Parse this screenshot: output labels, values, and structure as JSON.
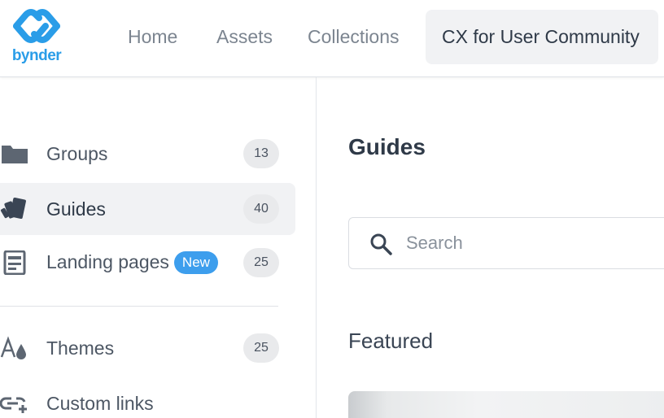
{
  "brand": {
    "logo_text": "bynder",
    "logo_color": "#2a9de8"
  },
  "nav": {
    "home": "Home",
    "assets": "Assets",
    "collections": "Collections",
    "active_portal": "CX for User Community"
  },
  "sidebar": {
    "items": [
      {
        "label": "Groups",
        "count": "13",
        "icon": "folder-icon"
      },
      {
        "label": "Guides",
        "count": "40",
        "icon": "guides-icon",
        "active": true
      },
      {
        "label": "Landing pages",
        "count": "25",
        "icon": "page-icon",
        "badge": "New"
      },
      {
        "label": "Themes",
        "count": "25",
        "icon": "theme-icon"
      },
      {
        "label": "Custom links",
        "icon": "custom-link-icon"
      }
    ]
  },
  "main": {
    "title": "Guides",
    "search": {
      "placeholder": "Search",
      "value": ""
    },
    "featured_title": "Featured"
  },
  "colors": {
    "accent": "#3d9eed",
    "active_bg": "#f1f2f4",
    "text": "#3a4554"
  }
}
